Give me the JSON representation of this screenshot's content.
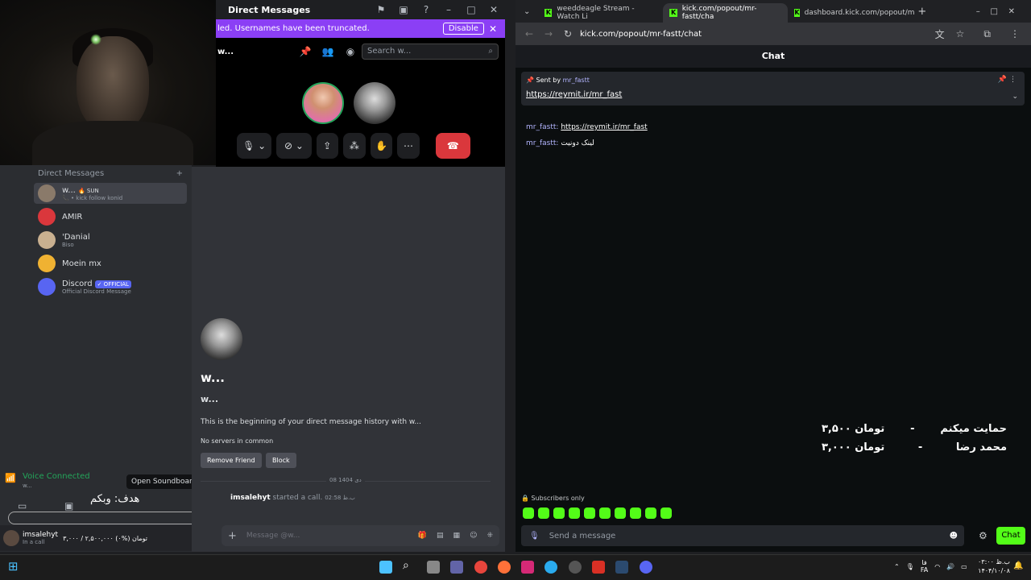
{
  "discord": {
    "window_title": "Direct Messages",
    "notice": {
      "text": "led. Usernames have been truncated.",
      "button": "Disable"
    },
    "dm_user_short": "w...",
    "search_placeholder": "Search w...",
    "sidebar_header": "Direct Messages",
    "dms": [
      {
        "name": "w...",
        "badge": "🔥 SUN",
        "status": "📞 • kick follow konid"
      },
      {
        "name": "AMIR",
        "status": ""
      },
      {
        "name": "'Danial",
        "status": "Biso"
      },
      {
        "name": "Moein mx",
        "status": ""
      },
      {
        "name": "Discord",
        "badge": "✓ OFFICIAL",
        "status": "Official Discord Message"
      }
    ],
    "voice_connected": "Voice Connected",
    "voice_sub": "w...",
    "tooltip": "Open Soundboard",
    "goal_text": "هدف: وبکم",
    "goal_progress_label": "%۰",
    "goal_amount": "۳,۰۰۰ / ۲,۵۰۰,۰۰۰ تومان (%۰)",
    "user": {
      "name": "imsalehyt",
      "status": "In a call"
    },
    "profile_name": "w...",
    "profile_user": "w...",
    "begin_text": "This is the beginning of your direct message history with w...",
    "no_servers": "No servers in common",
    "remove_friend": "Remove Friend",
    "block": "Block",
    "date_label": "08 دی 1404",
    "call_user": "imsalehyt",
    "call_text": " started a call.",
    "call_time": "02:58 ب.ظ",
    "message_placeholder": "Message @w..."
  },
  "chrome": {
    "tabs": [
      {
        "title": "weeddeagle Stream - Watch Li"
      },
      {
        "title": "kick.com/popout/mr-fastt/cha"
      },
      {
        "title": "dashboard.kick.com/popout/m"
      }
    ],
    "url": "kick.com/popout/mr-fastt/chat",
    "chat_title": "Chat",
    "pinned_sentby": "Sent by",
    "pinned_user": "mr_fastt",
    "pinned_link": "https://reymit.ir/mr_fast",
    "messages": [
      {
        "user": "mr_fastt:",
        "text": "https://reymit.ir/mr_fast"
      },
      {
        "user": "mr_fastt:",
        "text": "لینک دونیت"
      }
    ],
    "donations": [
      {
        "name": "حمایت میکنم",
        "sep": "-",
        "amount": "۳,۵۰۰ تومان"
      },
      {
        "name": "محمد رضا",
        "sep": "-",
        "amount": "۳,۰۰۰ تومان"
      }
    ],
    "subscribers_only": "Subscribers only",
    "send_placeholder": "Send a message",
    "chat_button": "Chat"
  },
  "taskbar": {
    "lang": "FA",
    "lang_top": "فا",
    "time": "۰۳:۰۰ ب.ظ",
    "date": "۱۴۰۴/۱۰/۰۸"
  },
  "colors": {
    "discord_accent": "#5865f2",
    "kick_green": "#53fc18",
    "notice_purple": "#8b3ff5",
    "end_call": "#da373c"
  }
}
